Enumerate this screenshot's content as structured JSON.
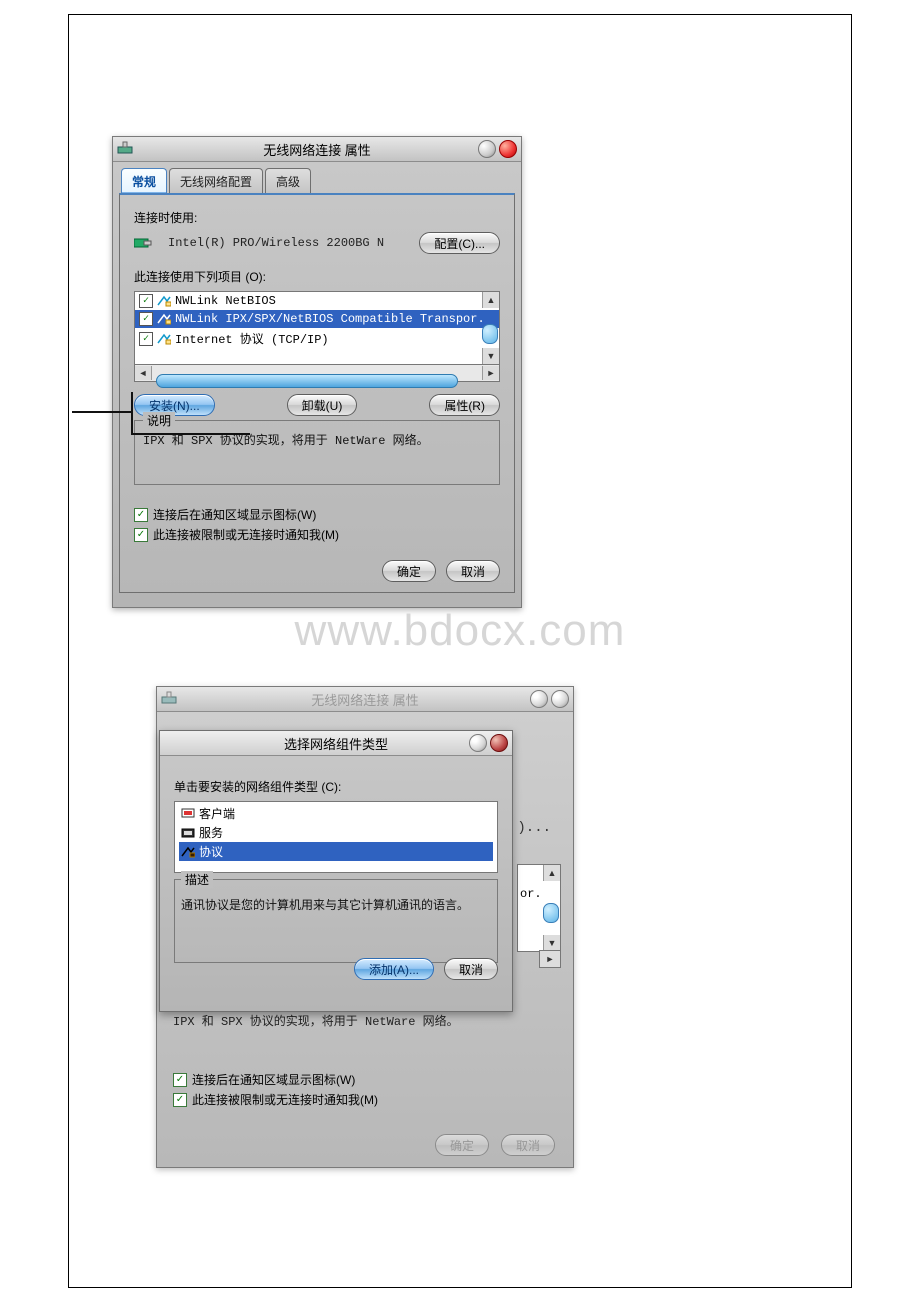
{
  "watermark": "www.bdocx.com",
  "dlg1": {
    "title": "无线网络连接 属性",
    "tabs": [
      "常规",
      "无线网络配置",
      "高级"
    ],
    "active_tab_index": 0,
    "connect_using_label": "连接时使用:",
    "adapter": "Intel(R) PRO/Wireless 2200BG N",
    "configure": "配置(C)...",
    "items_label": "此连接使用下列项目 (O):",
    "list": [
      {
        "checked": true,
        "selected": false,
        "text": "NWLink NetBIOS"
      },
      {
        "checked": true,
        "selected": true,
        "text": "NWLink IPX/SPX/NetBIOS Compatible Transpor."
      },
      {
        "checked": true,
        "selected": false,
        "text": "Internet 协议 (TCP/IP)"
      }
    ],
    "install": "安装(N)...",
    "uninstall": "卸载(U)",
    "properties": "属性(R)",
    "desc_caption": "说明",
    "desc_text": "IPX 和 SPX 协议的实现，将用于 NetWare 网络。",
    "check1": "连接后在通知区域显示图标(W)",
    "check2": "此连接被限制或无连接时通知我(M)",
    "ok": "确定",
    "cancel": "取消"
  },
  "dlg2": {
    "outer_title": "无线网络连接 属性",
    "inner_title": "选择网络组件类型",
    "prompt": "单击要安装的网络组件类型 (C):",
    "types": [
      {
        "selected": false,
        "text": "客户端"
      },
      {
        "selected": false,
        "text": "服务"
      },
      {
        "selected": true,
        "text": "协议"
      }
    ],
    "desc_caption": "描述",
    "desc_text": "通讯协议是您的计算机用来与其它计算机通讯的语言。",
    "add": "添加(A)...",
    "cancel": "取消",
    "peek_text": "or.",
    "ellipsis_hint": ")...",
    "outer_desc": "IPX 和 SPX 协议的实现，将用于 NetWare 网络。",
    "check1": "连接后在通知区域显示图标(W)",
    "check2": "此连接被限制或无连接时通知我(M)",
    "ok": "确定",
    "outer_cancel": "取消"
  }
}
